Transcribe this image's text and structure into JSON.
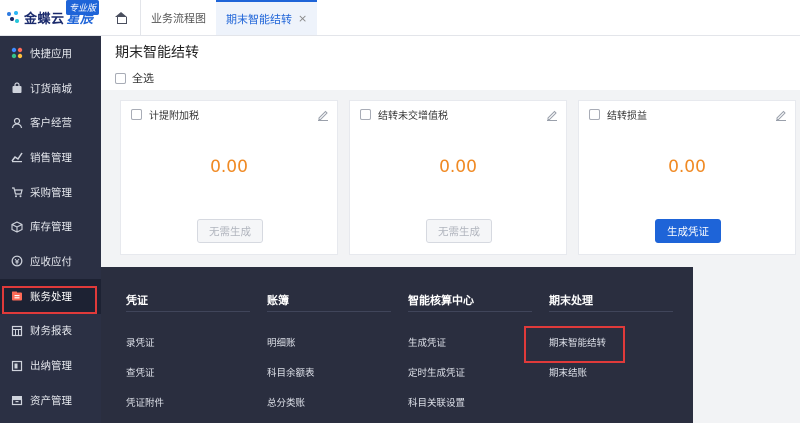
{
  "brand": {
    "name": "金蝶云",
    "sub": "星辰",
    "badge": "专业版"
  },
  "sidebar": {
    "items": [
      {
        "label": "快捷应用",
        "icon": "grid-icon"
      },
      {
        "label": "订货商城",
        "icon": "bag-icon"
      },
      {
        "label": "客户经营",
        "icon": "customer-icon"
      },
      {
        "label": "销售管理",
        "icon": "sales-icon"
      },
      {
        "label": "采购管理",
        "icon": "cart-icon"
      },
      {
        "label": "库存管理",
        "icon": "cube-icon"
      },
      {
        "label": "应收应付",
        "icon": "receivable-icon"
      },
      {
        "label": "账务处理",
        "icon": "accounting-icon"
      },
      {
        "label": "财务报表",
        "icon": "report-icon"
      },
      {
        "label": "出纳管理",
        "icon": "cashier-icon"
      },
      {
        "label": "资产管理",
        "icon": "asset-icon"
      }
    ]
  },
  "tabs": {
    "home_icon": "home-icon",
    "items": [
      {
        "label": "业务流程图"
      },
      {
        "label": "期末智能结转",
        "close": "×"
      }
    ]
  },
  "page": {
    "title": "期末智能结转",
    "select_all": "全选"
  },
  "cards": [
    {
      "title": "计提附加税",
      "amount": "0.00",
      "button": "无需生成",
      "button_state": "disabled"
    },
    {
      "title": "结转未交增值税",
      "amount": "0.00",
      "button": "无需生成",
      "button_state": "disabled"
    },
    {
      "title": "结转损益",
      "amount": "0.00",
      "button": "生成凭证",
      "button_state": "primary"
    }
  ],
  "dropdown": {
    "columns": [
      {
        "title": "凭证",
        "items": [
          "录凭证",
          "查凭证",
          "凭证附件"
        ]
      },
      {
        "title": "账簿",
        "items": [
          "明细账",
          "科目余额表",
          "总分类账"
        ]
      },
      {
        "title": "智能核算中心",
        "items": [
          "生成凭证",
          "定时生成凭证",
          "科目关联设置"
        ]
      },
      {
        "title": "期末处理",
        "items": [
          "期末智能结转",
          "期末结账"
        ]
      }
    ]
  },
  "colors": {
    "accent": "#1e64d8",
    "amount": "#f08a24",
    "sidebar_bg": "#2b3044",
    "panel_bg": "#2a2e3f",
    "highlight": "#e03a3a"
  }
}
